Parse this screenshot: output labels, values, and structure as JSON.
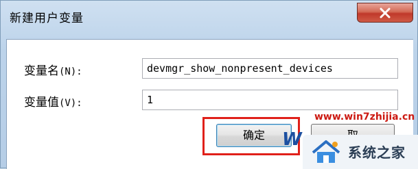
{
  "dialog": {
    "title": "新建用户变量",
    "close_icon": "close-icon"
  },
  "form": {
    "name_label": "变量名",
    "name_accel": "(N):",
    "name_value": "devmgr_show_nonpresent_devices",
    "value_label": "变量值",
    "value_accel": "(V):",
    "value_value": "1"
  },
  "buttons": {
    "ok_label": "确定",
    "cancel_label": "取"
  },
  "watermark": {
    "url": "www.win7zhijia.cn",
    "logo_letter": "W",
    "site_name": "系统之家"
  },
  "colors": {
    "highlight": "#e0201a",
    "close_button": "#c0392b",
    "focus_border": "#3c7fb1"
  }
}
